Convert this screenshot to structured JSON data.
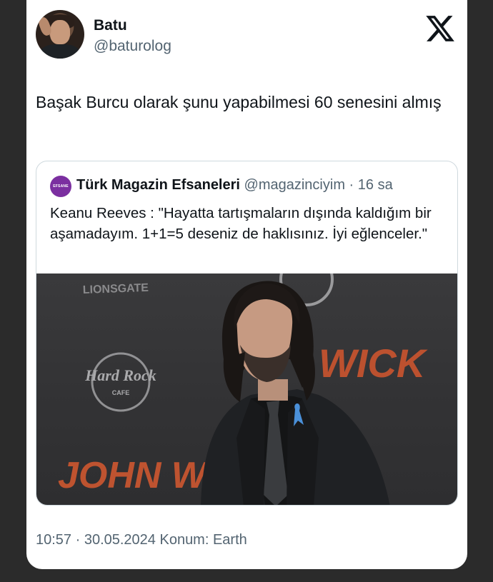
{
  "tweet": {
    "author_name": "Batu",
    "author_handle": "@baturolog",
    "text": "Başak Burcu olarak şunu yapabilmesi 60 senesini almış",
    "timestamp": "10:57 · 30.05.2024 Konum: Earth"
  },
  "quoted_tweet": {
    "avatar_text": "EFSANE",
    "author_name": "Türk Magazin Efsaneleri",
    "author_handle": "@magazinciyim",
    "time_ago": "· 16 sa",
    "text": "Keanu Reeves : \"Hayatta tartışmaların dışında kaldığım bir aşamadayım. 1+1=5 deseniz de haklısınız. İyi eğlenceler.\"",
    "image_texts": {
      "brand_top": "LIONSGATE",
      "brand_logo": "Hard Rock",
      "brand_logo_sub": "CAFE",
      "movie_title_bottom": "JOHN WICK",
      "movie_title_right": "WICK"
    }
  },
  "icons": {
    "platform_logo": "x-logo-icon"
  },
  "colors": {
    "primary_text": "#0f1419",
    "secondary_text": "#536471",
    "border": "#cfd9de",
    "background": "#2b2b2b"
  }
}
